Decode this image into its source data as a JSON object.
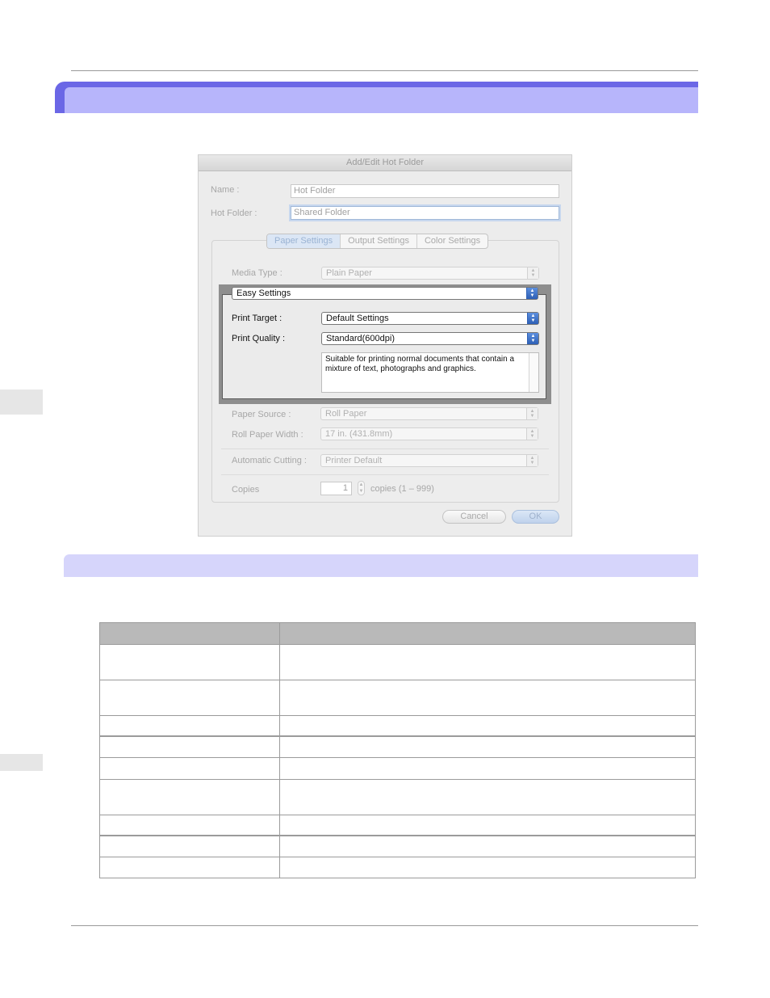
{
  "dialog": {
    "title": "Add/Edit Hot Folder",
    "name_label": "Name :",
    "name_value": "Hot Folder",
    "hotfolder_label": "Hot Folder :",
    "hotfolder_value": "Shared Folder",
    "tabs": [
      {
        "label": "Paper Settings",
        "active": true
      },
      {
        "label": "Output Settings",
        "active": false
      },
      {
        "label": "Color Settings",
        "active": false
      }
    ],
    "media_type_label": "Media Type :",
    "media_type_value": "Plain Paper",
    "easy_settings_value": "Easy Settings",
    "print_target_label": "Print Target :",
    "print_target_value": "Default Settings",
    "print_quality_label": "Print Quality :",
    "print_quality_value": "Standard(600dpi)",
    "description": "Suitable for printing normal documents that contain a mixture of text, photographs and graphics.",
    "paper_source_label": "Paper Source :",
    "paper_source_value": "Roll Paper",
    "roll_width_label": "Roll Paper Width :",
    "roll_width_value": "17 in. (431.8mm)",
    "auto_cut_label": "Automatic Cutting :",
    "auto_cut_value": "Printer Default",
    "copies_label": "Copies",
    "copies_value": "1",
    "copies_range": "copies (1 – 999)",
    "cancel_label": "Cancel",
    "ok_label": "OK"
  },
  "table": {
    "headers": [
      "",
      ""
    ],
    "rows": [
      [
        "",
        ""
      ],
      [
        "",
        ""
      ],
      [
        "",
        ""
      ],
      [
        "",
        ""
      ],
      [
        "",
        ""
      ],
      [
        "",
        ""
      ],
      [
        "",
        ""
      ],
      [
        "",
        ""
      ],
      [
        "",
        ""
      ]
    ]
  },
  "colors": {
    "header_band": "#6b67e6",
    "header_band_light": "#b7b5fb",
    "subheader_band": "#d6d5fb",
    "table_header": "#b9b9b9"
  }
}
